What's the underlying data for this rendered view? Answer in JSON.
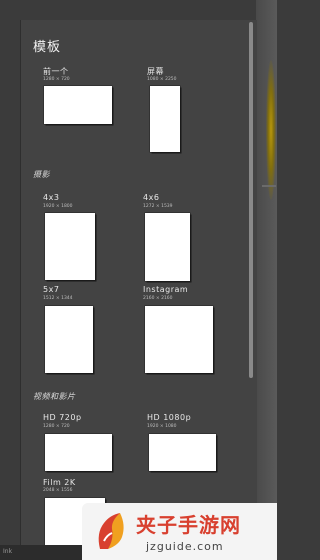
{
  "panel": {
    "title": "模板",
    "top": {
      "items": [
        {
          "label": "前一个",
          "dims": "1280 × 720"
        },
        {
          "label": "屏幕",
          "dims": "1080 × 2250"
        }
      ]
    },
    "sections": [
      {
        "title": "摄影",
        "items": [
          {
            "label": "4x3",
            "dims": "1920 × 1800"
          },
          {
            "label": "4x6",
            "dims": "1272 × 1539"
          },
          {
            "label": "5x7",
            "dims": "1512 × 1344"
          },
          {
            "label": "Instagram",
            "dims": "2160 × 2160"
          }
        ]
      },
      {
        "title": "视频和影片",
        "items": [
          {
            "label": "HD 720p",
            "dims": "1280 × 720"
          },
          {
            "label": "HD 1080p",
            "dims": "1920 × 1080"
          },
          {
            "label": "Film 2K",
            "dims": "2048 × 1556"
          }
        ]
      }
    ]
  },
  "watermark": {
    "title": "夹子手游网",
    "url": "jzguide.com"
  },
  "bottom_bar": {
    "text": "Ink"
  },
  "colors": {
    "panel_bg": "#434343",
    "card": "#ffffff",
    "accent_yellow": "#c9a300",
    "watermark_red": "#d8402f"
  }
}
